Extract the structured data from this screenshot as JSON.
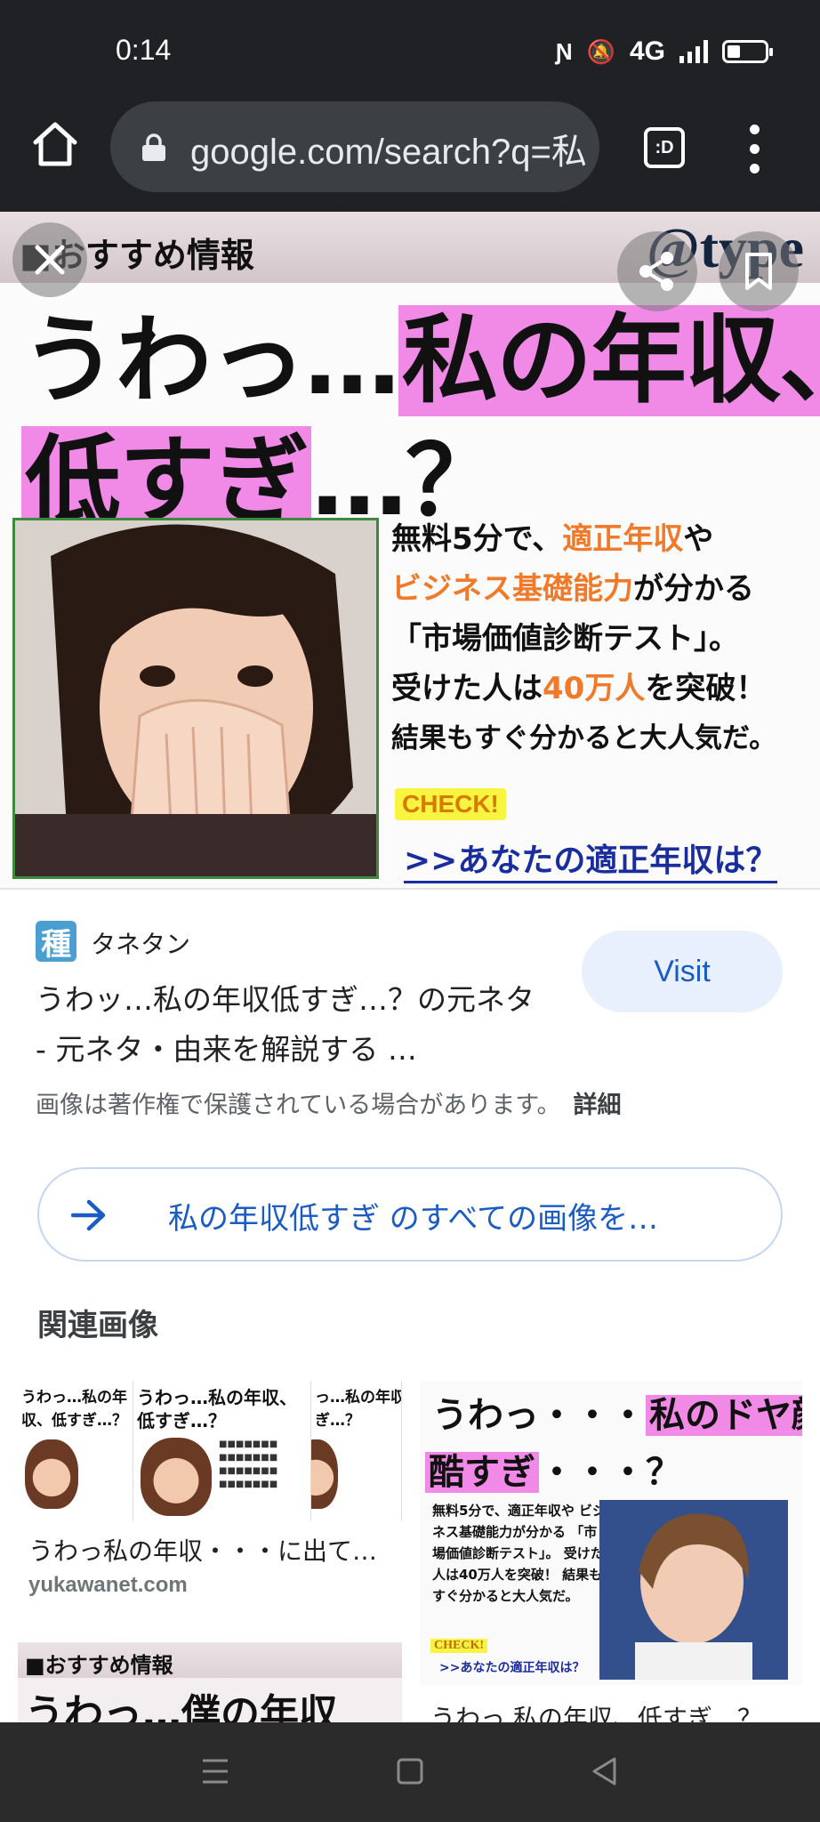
{
  "status_bar": {
    "time": "0:14",
    "network": "4G"
  },
  "browser": {
    "url": "google.com/search?q=私",
    "tab_switcher_label": ":D"
  },
  "hero_image": {
    "small_heading": "■おすすめ情報",
    "brand": "@type",
    "headline_1a": "うわっ…",
    "headline_1b": "私の年収、",
    "headline_2a": "低すぎ",
    "headline_2b": "…？",
    "copy_1a": "無料5分で、",
    "copy_1b": "適正年収",
    "copy_1c": "や",
    "copy_2a": "ビジネス基礎能力",
    "copy_2b": "が分かる",
    "copy_3": "「市場価値診断テスト」。",
    "copy_4a": "受けた人は",
    "copy_4b": "40万人",
    "copy_4c": "を突破！",
    "copy_5": "結果もすぐ分かると大人気だ。",
    "check": "CHECK!",
    "link": ">>あなたの適正年収は？"
  },
  "result": {
    "source_icon": "種",
    "source": "タネタン",
    "title": "うわッ…私の年収低すぎ…？の元ネタ - 元ネタ・由来を解説する …",
    "visit": "Visit",
    "copyright": "画像は著作権で保護されている場合があります。",
    "details": "詳細",
    "all_images": "私の年収低すぎ のすべての画像を…"
  },
  "related": {
    "heading": "関連画像",
    "items": [
      {
        "caption": "うわっ私の年収・・・に出て…",
        "domain": "yukawanet.com",
        "h_left_1": "うわっ…私の年",
        "h_left_2": "収、低すぎ…？",
        "h_mid_1": "うわっ…私の年収、",
        "h_mid_2": "低すぎ…？",
        "h_right_1": "っ…私の年収、",
        "h_right_2": "ぎ…？"
      },
      {
        "caption": "うわっ 私の年収、低すぎ…？",
        "h1a": "うわっ・・・",
        "h1b": "私のドヤ顔、",
        "h2a": "酷すぎ",
        "h2b": "・・・？",
        "copy": "無料5分で、適正年収や ビジネス基礎能力が分かる 「市場価値診断テスト」。 受けた人は40万人を突破！ 結果もすぐ分かると大人気だ。",
        "check": "CHECK!",
        "link": ">>あなたの適正年収は？"
      },
      {
        "small_heading": "■おすすめ情報",
        "headline": "うわっ…僕の年収"
      }
    ]
  }
}
